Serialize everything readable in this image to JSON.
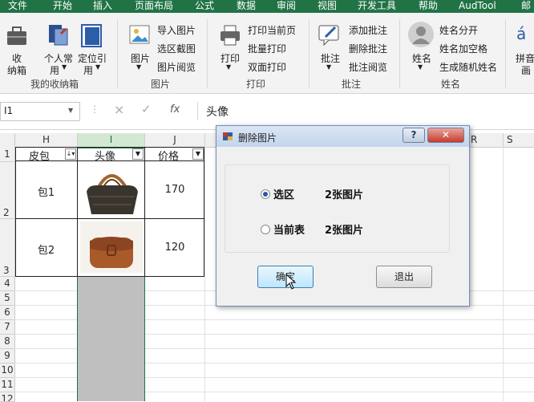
{
  "ribbon_tabs": [
    "文件",
    "开始",
    "插入",
    "页面布局",
    "公式",
    "数据",
    "审阅",
    "视图",
    "开发工具",
    "帮助",
    "AudTool",
    "邮"
  ],
  "ribbon": {
    "toolbox": {
      "line1": "收",
      "line2": "纳箱"
    },
    "personal": {
      "line1": "个人常",
      "line2": "用"
    },
    "locate": {
      "line1": "定位引",
      "line2": "用"
    },
    "group1_label": "我的收纳箱",
    "picture_btn": "图片",
    "import_picture": "导入图片",
    "select_crop": "选区截图",
    "picture_browse": "图片阅览",
    "group2_label": "图片",
    "print_btn": "打印",
    "print_current_page": "打印当前页",
    "batch_print": "批量打印",
    "duplex_print": "双面打印",
    "group3_label": "打印",
    "comment_btn": "批注",
    "add_comment": "添加批注",
    "delete_comment": "删除批注",
    "comment_browse": "批注阅览",
    "group4_label": "批注",
    "name_btn": "姓名",
    "name_split": "姓名分开",
    "name_add_space": "姓名加空格",
    "random_name": "生成随机姓名",
    "group5_label": "姓名",
    "pinyin_btn": {
      "line1": "拼音",
      "line2": "画"
    }
  },
  "formula_bar": {
    "name_box": "I1",
    "cancel_glyph": "×",
    "confirm_glyph": "✓",
    "fx": "fx",
    "content": "头像"
  },
  "sheet": {
    "columns": [
      "H",
      "I",
      "J",
      "R",
      "S"
    ],
    "rows": [
      "1",
      "2",
      "3",
      "4",
      "5",
      "6",
      "7",
      "8",
      "9",
      "10",
      "11",
      "12"
    ],
    "headers": {
      "h": "皮包",
      "i": "头像",
      "j": "价格"
    },
    "data": [
      {
        "bag": "包1",
        "price": "170"
      },
      {
        "bag": "包2",
        "price": "120"
      }
    ]
  },
  "dialog": {
    "title": "删除图片",
    "help_glyph": "?",
    "close_glyph": "✕",
    "option_selection": "选区",
    "option_selection_count": "2张图片",
    "option_sheet": "当前表",
    "option_sheet_count": "2张图片",
    "ok_label": "确定",
    "exit_label": "退出",
    "selected_option": "选区"
  },
  "colors": {
    "excel_green": "#217346",
    "selected_col": "#bfbfbf",
    "accent_blue": "#2a56a8"
  }
}
